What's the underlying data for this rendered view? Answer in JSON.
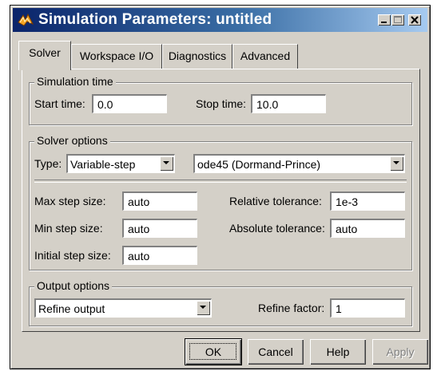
{
  "window": {
    "title": "Simulation Parameters: untitled"
  },
  "tabs": [
    {
      "label": "Solver",
      "active": true
    },
    {
      "label": "Workspace I/O",
      "active": false
    },
    {
      "label": "Diagnostics",
      "active": false
    },
    {
      "label": "Advanced",
      "active": false
    }
  ],
  "simulation_time": {
    "title": "Simulation time",
    "start_label": "Start time:",
    "start_value": "0.0",
    "stop_label": "Stop time:",
    "stop_value": "10.0"
  },
  "solver_options": {
    "title": "Solver options",
    "type_label": "Type:",
    "type_value": "Variable-step",
    "solver_value": "ode45 (Dormand-Prince)",
    "max_step_label": "Max step size:",
    "max_step_value": "auto",
    "min_step_label": "Min step size:",
    "min_step_value": "auto",
    "initial_step_label": "Initial step size:",
    "initial_step_value": "auto",
    "rel_tol_label": "Relative tolerance:",
    "rel_tol_value": "1e-3",
    "abs_tol_label": "Absolute tolerance:",
    "abs_tol_value": "auto"
  },
  "output_options": {
    "title": "Output options",
    "mode_value": "Refine output",
    "refine_label": "Refine factor:",
    "refine_value": "1"
  },
  "buttons": {
    "ok": "OK",
    "cancel": "Cancel",
    "help": "Help",
    "apply": "Apply"
  },
  "icons": {
    "app": "simulink-icon",
    "minimize": "minimize-icon",
    "maximize": "maximize-icon",
    "close": "close-icon",
    "dropdown": "chevron-down-icon"
  },
  "colors": {
    "title_bar_start": "#0a246a",
    "title_bar_end": "#a6caf0",
    "face": "#d4d0c8"
  }
}
